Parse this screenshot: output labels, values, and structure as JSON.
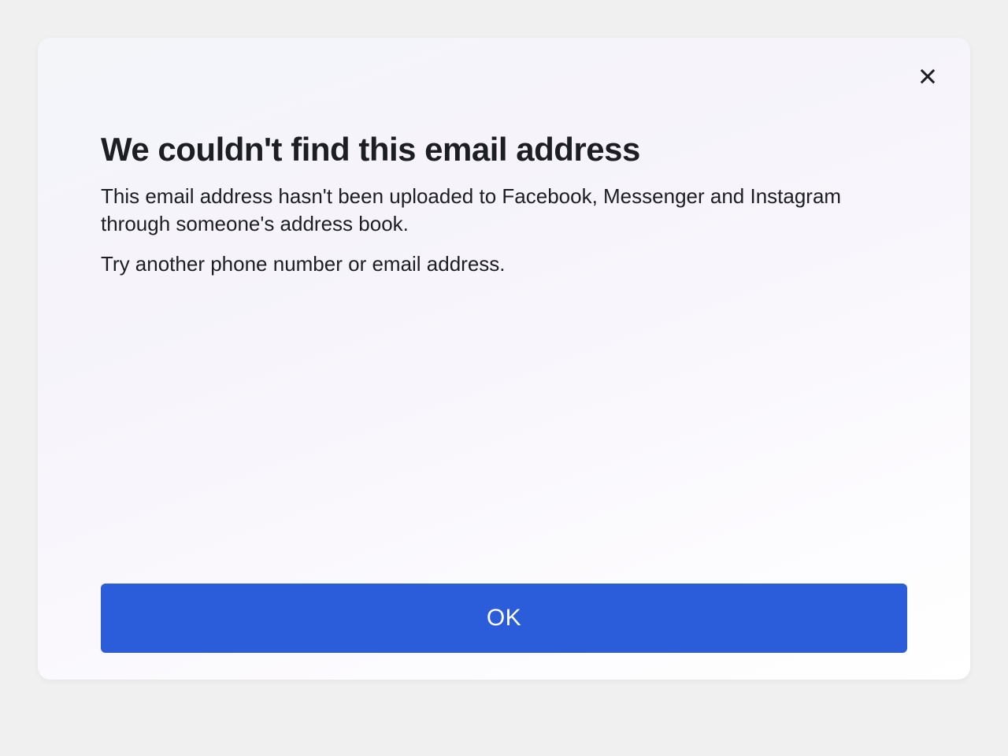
{
  "dialog": {
    "title": "We couldn't find this email address",
    "message1": "This email address hasn't been uploaded to Facebook, Messenger and Instagram through someone's address book.",
    "message2": "Try another phone number or email address.",
    "ok_label": "OK"
  }
}
